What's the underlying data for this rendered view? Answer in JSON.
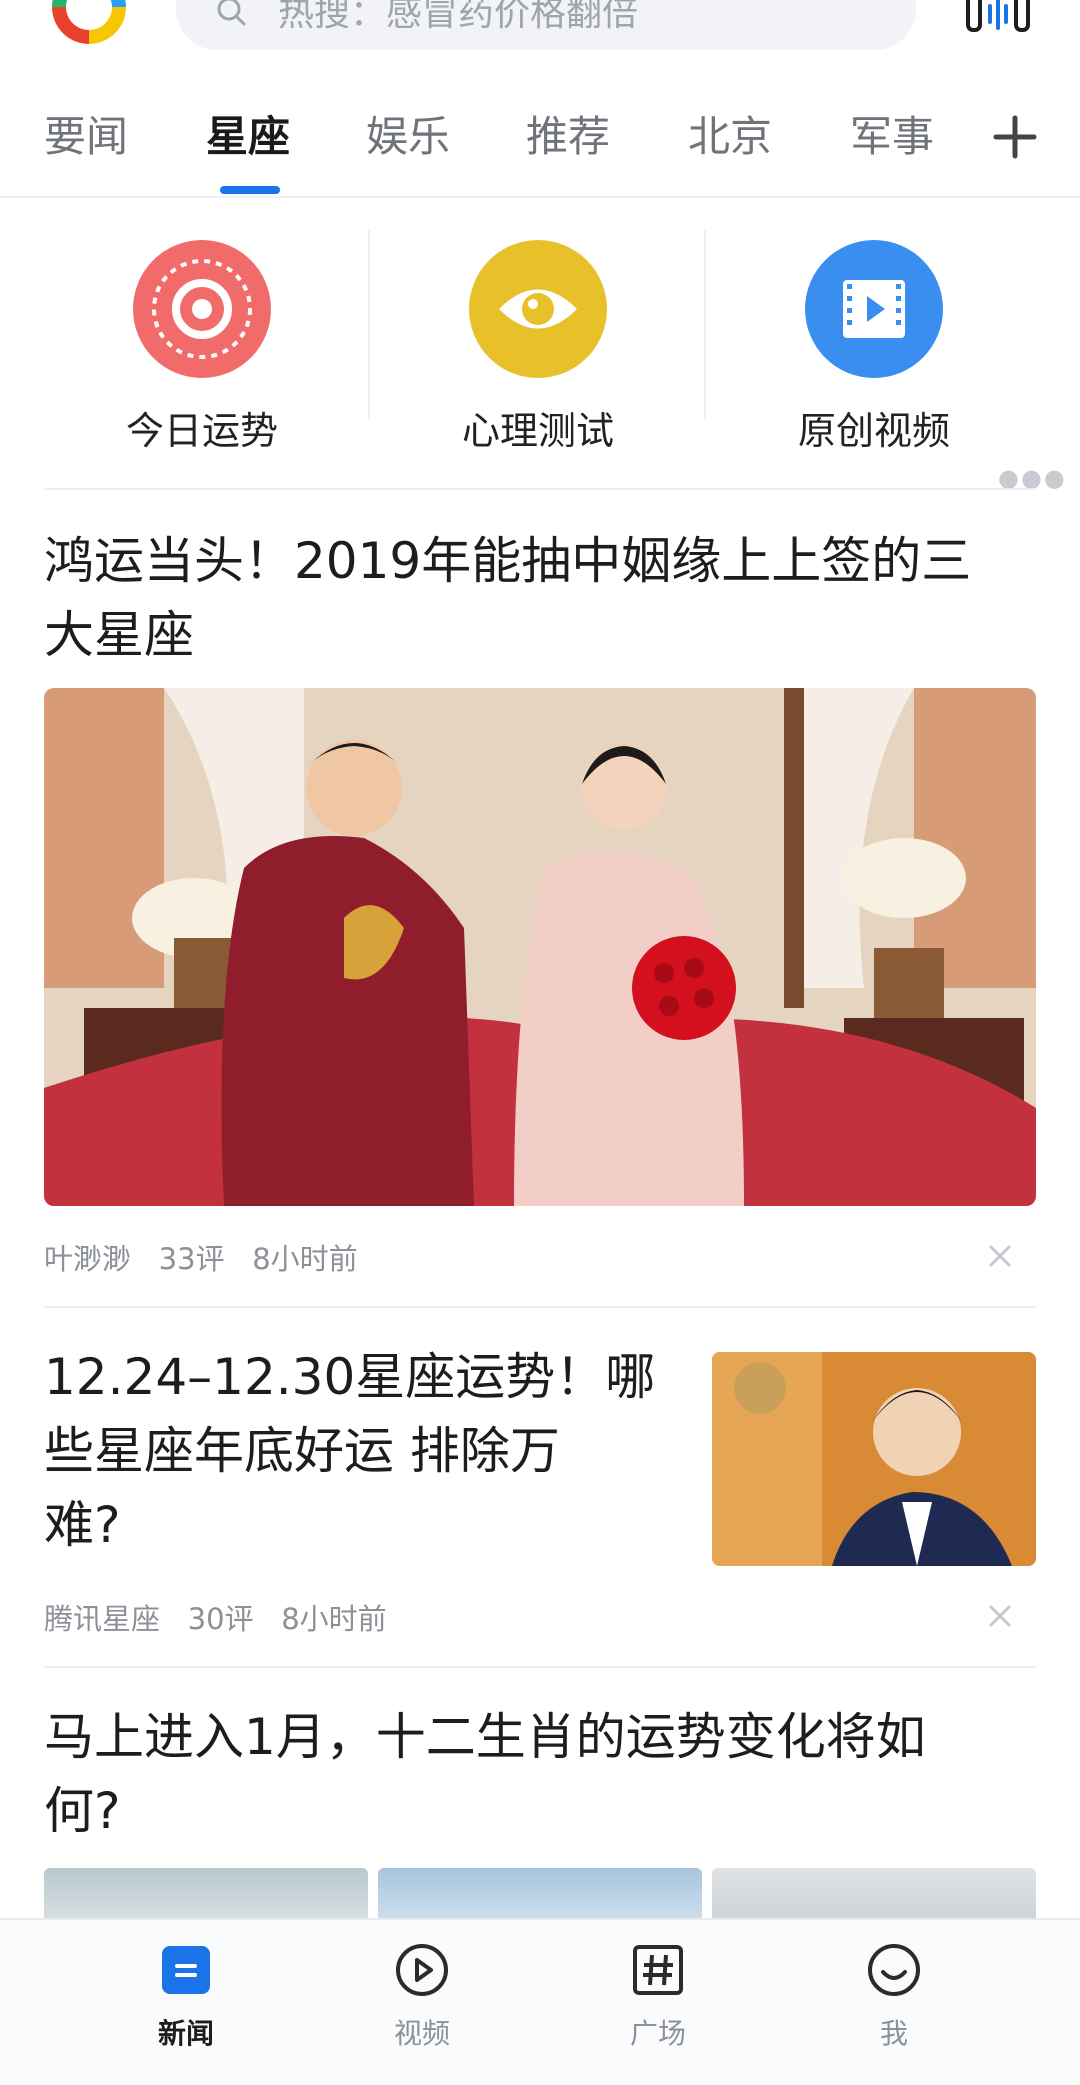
{
  "search": {
    "placeholder": "热搜：感冒药价格翻倍"
  },
  "tabs": [
    {
      "label": "要闻",
      "active": false
    },
    {
      "label": "星座",
      "active": true
    },
    {
      "label": "娱乐",
      "active": false
    },
    {
      "label": "推荐",
      "active": false
    },
    {
      "label": "北京",
      "active": false
    },
    {
      "label": "军事",
      "active": false
    }
  ],
  "entries": [
    {
      "label": "今日运势",
      "icon": "astrolabe-icon",
      "color": "#f16b6b"
    },
    {
      "label": "心理测试",
      "icon": "eye-icon",
      "color": "#e8c12a"
    },
    {
      "label": "原创视频",
      "icon": "video-play-icon",
      "color": "#3a8ef0"
    }
  ],
  "articles": [
    {
      "title_line1": "鸿运当头！2019年能抽中姻缘上上签的三",
      "title_line2": "大星座",
      "source": "叶渺渺",
      "comments": "33评",
      "time": "8小时前"
    },
    {
      "title_line1": "12.24–12.30星座运势！哪",
      "title_line2": "些星座年底好运 排除万",
      "title_line3": "难?",
      "source": "腾讯星座",
      "comments": "30评",
      "time": "8小时前"
    },
    {
      "title_line1": "马上进入1月，十二生肖的运势变化将如",
      "title_line2": "何?"
    }
  ],
  "bottom_nav": [
    {
      "label": "新闻",
      "icon": "news-icon",
      "active": true
    },
    {
      "label": "视频",
      "icon": "play-circle-icon",
      "active": false
    },
    {
      "label": "广场",
      "icon": "hashtag-icon",
      "active": false
    },
    {
      "label": "我",
      "icon": "smile-icon",
      "active": false
    }
  ],
  "colors": {
    "accent": "#1a73e8",
    "text_primary": "#1d1d1d",
    "text_secondary": "#8c9097"
  }
}
